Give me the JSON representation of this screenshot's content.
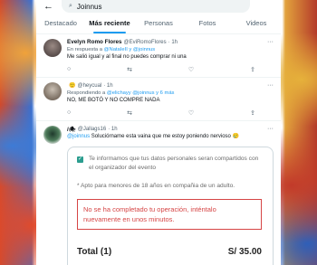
{
  "search": {
    "value": "Joinnus"
  },
  "tabs": [
    {
      "label": "Destacado"
    },
    {
      "label": "Más reciente"
    },
    {
      "label": "Personas"
    },
    {
      "label": "Fotos"
    },
    {
      "label": "Videos"
    }
  ],
  "tweets": [
    {
      "name": "Evelyn Romo Flores",
      "handle": "@EviRomoFlores",
      "time": "· 1h",
      "reply_prefix": "En respuesta a",
      "reply_to": "@NataIeII y @joinnus",
      "text": "Me salió igual y al final no puedes comprar ni una"
    },
    {
      "name": "",
      "handle": "@heycual",
      "time": "· 1h",
      "reply_prefix": "Respondiendo a",
      "reply_to": "@elichayy @joinnus y 6 más",
      "text": "NO, ME BOTÓ  Y NO COMPRE NADA"
    },
    {
      "name": "/🕷",
      "handle": "@Jallags16",
      "time": "· 1h",
      "mention": "@joinnus",
      "text": " Soluciórname esta vaina que me estoy poniendo nervioso 🥲",
      "card": {
        "consent": "Te informamos que tus datos personales seran compartidos con el organizador del evento",
        "note": "* Apto para menores de 18 años en compañia de un adulto.",
        "error": "No se ha completado tu operación, inténtalo nuevamente en unos minutos.",
        "total_label": "Total (1)",
        "total_value": "S/ 35.00"
      }
    }
  ]
}
